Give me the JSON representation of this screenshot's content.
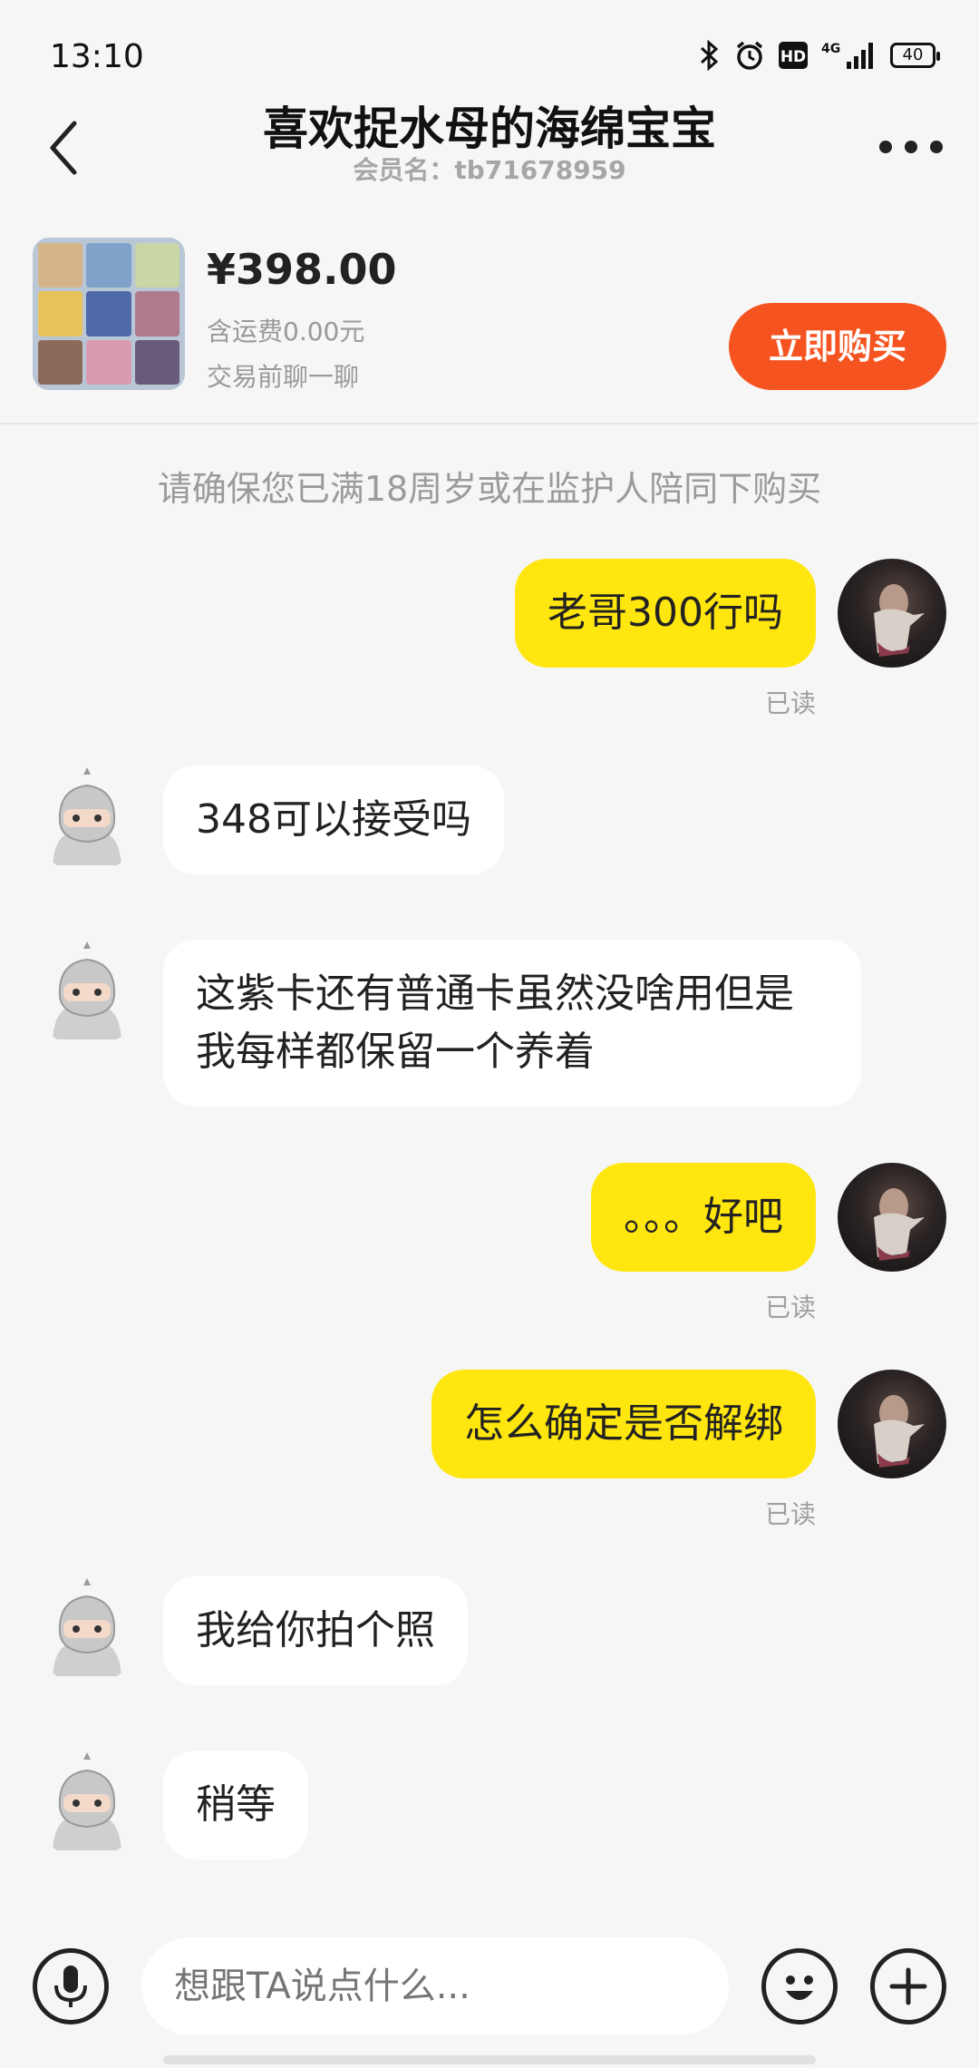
{
  "status_bar": {
    "time": "13:10",
    "battery": "40",
    "network": "4G"
  },
  "header": {
    "title": "喜欢捉水母的海绵宝宝",
    "subtitle": "会员名：tb71678959"
  },
  "product": {
    "price": "¥398.00",
    "shipping": "含运费0.00元",
    "chat_note": "交易前聊一聊",
    "buy_label": "立即购买"
  },
  "notice": "请确保您已满18周岁或在监护人陪同下购买",
  "messages": [
    {
      "sender": "me",
      "text": "老哥300行吗",
      "status": "已读"
    },
    {
      "sender": "seller",
      "text": "348可以接受吗"
    },
    {
      "sender": "seller",
      "text": "这紫卡还有普通卡虽然没啥用但是我每样都保留一个养着"
    },
    {
      "sender": "me",
      "text": "。。。好吧",
      "status": "已读"
    },
    {
      "sender": "me",
      "text": "怎么确定是否解绑",
      "status": "已读"
    },
    {
      "sender": "seller",
      "text": "我给你拍个照"
    },
    {
      "sender": "seller",
      "text": "稍等"
    }
  ],
  "input": {
    "placeholder": "想跟TA说点什么..."
  },
  "colors": {
    "accent": "#f5531f",
    "my_bubble": "#ffe60f",
    "background": "#f6f6f6"
  },
  "icons": [
    "back-icon",
    "more-icon",
    "microphone-icon",
    "emoji-icon",
    "plus-icon",
    "bluetooth-icon",
    "alarm-icon",
    "hd-icon",
    "signal-icon",
    "battery-icon"
  ]
}
